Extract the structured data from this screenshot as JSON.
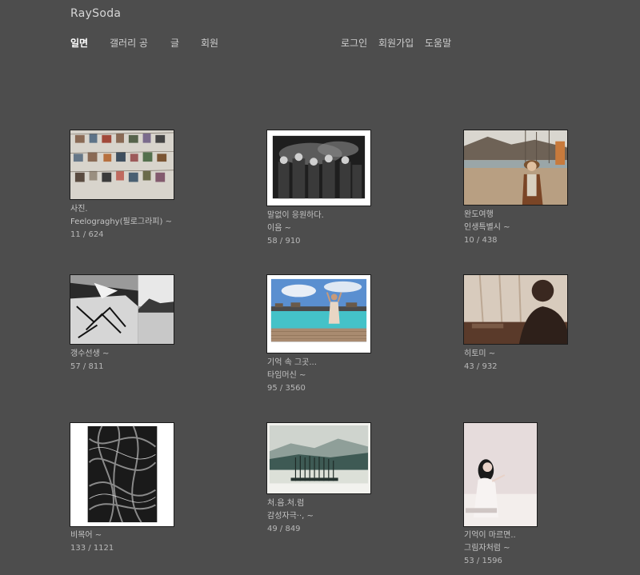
{
  "site": {
    "title": "RaySoda"
  },
  "nav": {
    "left": [
      "일면",
      "갤러리 공",
      "글",
      "회원"
    ],
    "right": [
      "로그인",
      "회원가입",
      "도움말"
    ]
  },
  "gallery": [
    {
      "title": "사진.",
      "author": "Feelograghy(필로그라피) ~",
      "stats": "11 / 624"
    },
    {
      "title": "말없이 응원하다.",
      "author": "이음 ~",
      "stats": "58 / 910"
    },
    {
      "title": "완도여행",
      "author": "인생특별시 ~",
      "stats": "10 / 438"
    },
    {
      "title": "",
      "author": "갱수선생 ~",
      "stats": "57 / 811"
    },
    {
      "title": "기억 속 그곳...",
      "author": "타임머신 ~",
      "stats": "95 / 3560"
    },
    {
      "title": "",
      "author": "히토미 ~",
      "stats": "43 / 932"
    },
    {
      "title": "",
      "author": "비목어 ~",
      "stats": "133 / 1121"
    },
    {
      "title": "처.음.처.럼",
      "author": "감성자극··,  ~",
      "stats": "49 / 849"
    },
    {
      "title": "기억이 마르면..",
      "author": "그림자처럼 ~",
      "stats": "53 / 1596"
    }
  ]
}
